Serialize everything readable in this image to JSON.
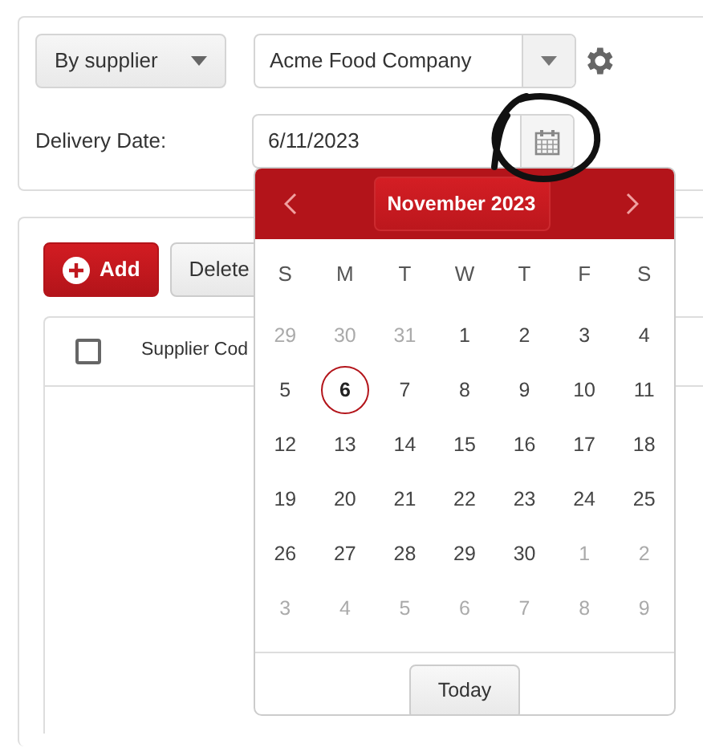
{
  "filter": {
    "mode": "By supplier",
    "supplier": "Acme Food Company"
  },
  "delivery_date": {
    "label": "Delivery Date:",
    "value": "6/11/2023"
  },
  "toolbar": [
    {
      "kind": "add",
      "label": "Add"
    },
    {
      "kind": "plain",
      "label": "Delete"
    }
  ],
  "grid": {
    "columns": [
      {
        "kind": "checkbox",
        "checked": false
      },
      {
        "kind": "text",
        "label": "Supplier Cod"
      }
    ]
  },
  "calendar": {
    "title": "November 2023",
    "weekdays": [
      "S",
      "M",
      "T",
      "W",
      "T",
      "F",
      "S"
    ],
    "weeks": [
      [
        {
          "day": "29",
          "other_month": true,
          "selected": false
        },
        {
          "day": "30",
          "other_month": true,
          "selected": false
        },
        {
          "day": "31",
          "other_month": true,
          "selected": false
        },
        {
          "day": "1",
          "other_month": false,
          "selected": false
        },
        {
          "day": "2",
          "other_month": false,
          "selected": false
        },
        {
          "day": "3",
          "other_month": false,
          "selected": false
        },
        {
          "day": "4",
          "other_month": false,
          "selected": false
        }
      ],
      [
        {
          "day": "5",
          "other_month": false,
          "selected": false
        },
        {
          "day": "6",
          "other_month": false,
          "selected": true
        },
        {
          "day": "7",
          "other_month": false,
          "selected": false
        },
        {
          "day": "8",
          "other_month": false,
          "selected": false
        },
        {
          "day": "9",
          "other_month": false,
          "selected": false
        },
        {
          "day": "10",
          "other_month": false,
          "selected": false
        },
        {
          "day": "11",
          "other_month": false,
          "selected": false
        }
      ],
      [
        {
          "day": "12",
          "other_month": false,
          "selected": false
        },
        {
          "day": "13",
          "other_month": false,
          "selected": false
        },
        {
          "day": "14",
          "other_month": false,
          "selected": false
        },
        {
          "day": "15",
          "other_month": false,
          "selected": false
        },
        {
          "day": "16",
          "other_month": false,
          "selected": false
        },
        {
          "day": "17",
          "other_month": false,
          "selected": false
        },
        {
          "day": "18",
          "other_month": false,
          "selected": false
        }
      ],
      [
        {
          "day": "19",
          "other_month": false,
          "selected": false
        },
        {
          "day": "20",
          "other_month": false,
          "selected": false
        },
        {
          "day": "21",
          "other_month": false,
          "selected": false
        },
        {
          "day": "22",
          "other_month": false,
          "selected": false
        },
        {
          "day": "23",
          "other_month": false,
          "selected": false
        },
        {
          "day": "24",
          "other_month": false,
          "selected": false
        },
        {
          "day": "25",
          "other_month": false,
          "selected": false
        }
      ],
      [
        {
          "day": "26",
          "other_month": false,
          "selected": false
        },
        {
          "day": "27",
          "other_month": false,
          "selected": false
        },
        {
          "day": "28",
          "other_month": false,
          "selected": false
        },
        {
          "day": "29",
          "other_month": false,
          "selected": false
        },
        {
          "day": "30",
          "other_month": false,
          "selected": false
        },
        {
          "day": "1",
          "other_month": true,
          "selected": false
        },
        {
          "day": "2",
          "other_month": true,
          "selected": false
        }
      ],
      [
        {
          "day": "3",
          "other_month": true,
          "selected": false
        },
        {
          "day": "4",
          "other_month": true,
          "selected": false
        },
        {
          "day": "5",
          "other_month": true,
          "selected": false
        },
        {
          "day": "6",
          "other_month": true,
          "selected": false
        },
        {
          "day": "7",
          "other_month": true,
          "selected": false
        },
        {
          "day": "8",
          "other_month": true,
          "selected": false
        },
        {
          "day": "9",
          "other_month": true,
          "selected": false
        }
      ]
    ],
    "today_button": "Today"
  }
}
